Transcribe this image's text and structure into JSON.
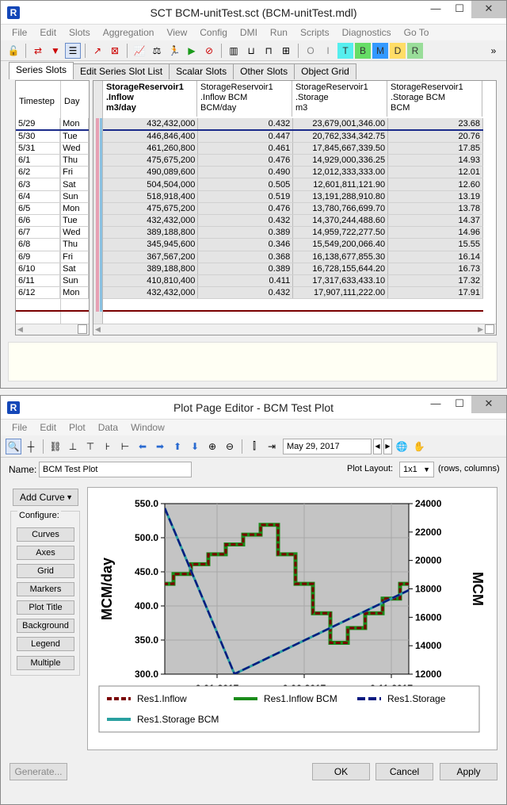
{
  "top_window": {
    "title": "SCT BCM-unitTest.sct (BCM-unitTest.mdl)",
    "menus": [
      "File",
      "Edit",
      "Slots",
      "Aggregation",
      "View",
      "Config",
      "DMI",
      "Run",
      "Scripts",
      "Diagnostics",
      "Go To"
    ],
    "tabs": [
      "Series Slots",
      "Edit Series Slot List",
      "Scalar Slots",
      "Other Slots",
      "Object Grid"
    ],
    "row_headers": [
      "Timestep",
      "Day"
    ],
    "columns": [
      {
        "l1": "StorageReservoir1",
        "l2": ".Inflow",
        "l3": "m3/day"
      },
      {
        "l1": "StorageReservoir1",
        "l2": ".Inflow BCM",
        "l3": "BCM/day"
      },
      {
        "l1": "StorageReservoir1",
        "l2": ".Storage",
        "l3": "m3"
      },
      {
        "l1": "StorageReservoir1",
        "l2": ".Storage BCM",
        "l3": "BCM"
      }
    ],
    "rows": [
      [
        "5/29",
        "Mon",
        "432,432,000",
        "0.432",
        "23,679,001,346.00",
        "23.68"
      ],
      [
        "5/30",
        "Tue",
        "446,846,400",
        "0.447",
        "20,762,334,342.75",
        "20.76"
      ],
      [
        "5/31",
        "Wed",
        "461,260,800",
        "0.461",
        "17,845,667,339.50",
        "17.85"
      ],
      [
        "6/1",
        "Thu",
        "475,675,200",
        "0.476",
        "14,929,000,336.25",
        "14.93"
      ],
      [
        "6/2",
        "Fri",
        "490,089,600",
        "0.490",
        "12,012,333,333.00",
        "12.01"
      ],
      [
        "6/3",
        "Sat",
        "504,504,000",
        "0.505",
        "12,601,811,121.90",
        "12.60"
      ],
      [
        "6/4",
        "Sun",
        "518,918,400",
        "0.519",
        "13,191,288,910.80",
        "13.19"
      ],
      [
        "6/5",
        "Mon",
        "475,675,200",
        "0.476",
        "13,780,766,699.70",
        "13.78"
      ],
      [
        "6/6",
        "Tue",
        "432,432,000",
        "0.432",
        "14,370,244,488.60",
        "14.37"
      ],
      [
        "6/7",
        "Wed",
        "389,188,800",
        "0.389",
        "14,959,722,277.50",
        "14.96"
      ],
      [
        "6/8",
        "Thu",
        "345,945,600",
        "0.346",
        "15,549,200,066.40",
        "15.55"
      ],
      [
        "6/9",
        "Fri",
        "367,567,200",
        "0.368",
        "16,138,677,855.30",
        "16.14"
      ],
      [
        "6/10",
        "Sat",
        "389,188,800",
        "0.389",
        "16,728,155,644.20",
        "16.73"
      ],
      [
        "6/11",
        "Sun",
        "410,810,400",
        "0.411",
        "17,317,633,433.10",
        "17.32"
      ],
      [
        "6/12",
        "Mon",
        "432,432,000",
        "0.432",
        "17,907,111,222.00",
        "17.91"
      ]
    ]
  },
  "plot_window": {
    "title": "Plot Page Editor - BCM Test Plot",
    "menus": [
      "File",
      "Edit",
      "Plot",
      "Data",
      "Window"
    ],
    "date_value": "May 29, 2017",
    "name_label": "Name:",
    "name_value": "BCM Test Plot",
    "layout_label": "Plot Layout:",
    "layout_value": "1x1",
    "layout_hint": "(rows, columns)",
    "add_curve": "Add Curve",
    "configure_label": "Configure:",
    "config_buttons": [
      "Curves",
      "Axes",
      "Grid",
      "Markers",
      "Plot Title",
      "Background",
      "Legend",
      "Multiple"
    ],
    "generate": "Generate...",
    "ok": "OK",
    "cancel": "Cancel",
    "apply": "Apply"
  },
  "chart_data": {
    "type": "line",
    "ylabel": "MCM/day",
    "y2label": "MCM",
    "ylim": [
      300,
      550
    ],
    "y2lim": [
      12000,
      24000
    ],
    "y_ticks": [
      "550.0",
      "500.0",
      "450.0",
      "400.0",
      "350.0",
      "300.0"
    ],
    "y2_ticks": [
      "24000",
      "22000",
      "20000",
      "18000",
      "16000",
      "14000",
      "12000"
    ],
    "x_ticks": [
      "6-01-2017",
      "6-06-2017",
      "6-11-2017"
    ],
    "x_tick_days": [
      4,
      9,
      14
    ],
    "x_range": [
      1,
      15
    ],
    "series": [
      {
        "name": "Res1.Inflow",
        "axis": "left",
        "step": true,
        "color": "#7a0000",
        "dash": "6,3",
        "values": [
          432.432,
          446.846,
          461.261,
          475.675,
          490.09,
          504.504,
          518.918,
          475.675,
          432.432,
          389.189,
          345.946,
          367.567,
          389.189,
          410.81,
          432.432
        ]
      },
      {
        "name": "Res1.Inflow BCM",
        "axis": "left",
        "step": true,
        "color": "#1a8c1a",
        "dash": "",
        "values": [
          432.432,
          446.846,
          461.261,
          475.675,
          490.09,
          504.504,
          518.918,
          475.675,
          432.432,
          389.189,
          345.946,
          367.567,
          389.189,
          410.81,
          432.432
        ]
      },
      {
        "name": "Res1.Storage",
        "axis": "right",
        "step": false,
        "color": "#0a1a80",
        "dash": "10,4",
        "values": [
          23679.0,
          20762.3,
          17845.7,
          14929.0,
          12012.3,
          12601.8,
          13191.3,
          13780.8,
          14370.2,
          14959.7,
          15549.2,
          16138.7,
          16728.2,
          17317.6,
          17907.1
        ]
      },
      {
        "name": "Res1.Storage BCM",
        "axis": "right",
        "step": false,
        "color": "#2aa0a0",
        "dash": "",
        "values": [
          23679.0,
          20762.3,
          17845.7,
          14929.0,
          12012.3,
          12601.8,
          13191.3,
          13780.8,
          14370.2,
          14959.7,
          15549.2,
          16138.7,
          16728.2,
          17317.6,
          17907.1
        ]
      }
    ]
  }
}
